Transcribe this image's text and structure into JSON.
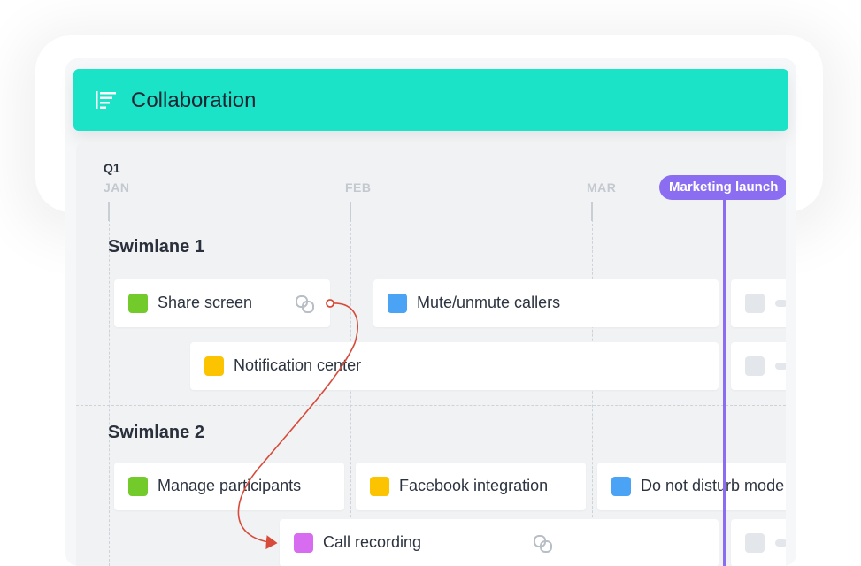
{
  "header": {
    "title": "Collaboration",
    "icon": "timeline-icon"
  },
  "timeline": {
    "quarter": "Q1",
    "months": [
      "JAN",
      "FEB",
      "MAR"
    ],
    "milestone": "Marketing launch"
  },
  "swimlanes": [
    {
      "title": "Swimlane 1"
    },
    {
      "title": "Swimlane 2"
    }
  ],
  "cards": {
    "share_screen": {
      "label": "Share screen",
      "color": "#72cb2b"
    },
    "mute": {
      "label": "Mute/unmute callers",
      "color": "#4aa3f5"
    },
    "notification": {
      "label": "Notification center",
      "color": "#fcc300"
    },
    "manage": {
      "label": "Manage participants",
      "color": "#72cb2b"
    },
    "facebook": {
      "label": "Facebook integration",
      "color": "#fcc300"
    },
    "dnd": {
      "label": "Do not disturb mode",
      "color": "#4aa3f5"
    },
    "call_recording": {
      "label": "Call recording",
      "color": "#d86cf0"
    }
  },
  "colors": {
    "header_bg": "#1ae3c7",
    "milestone": "#8b6df2",
    "dependency_arrow": "#d84a3a"
  }
}
